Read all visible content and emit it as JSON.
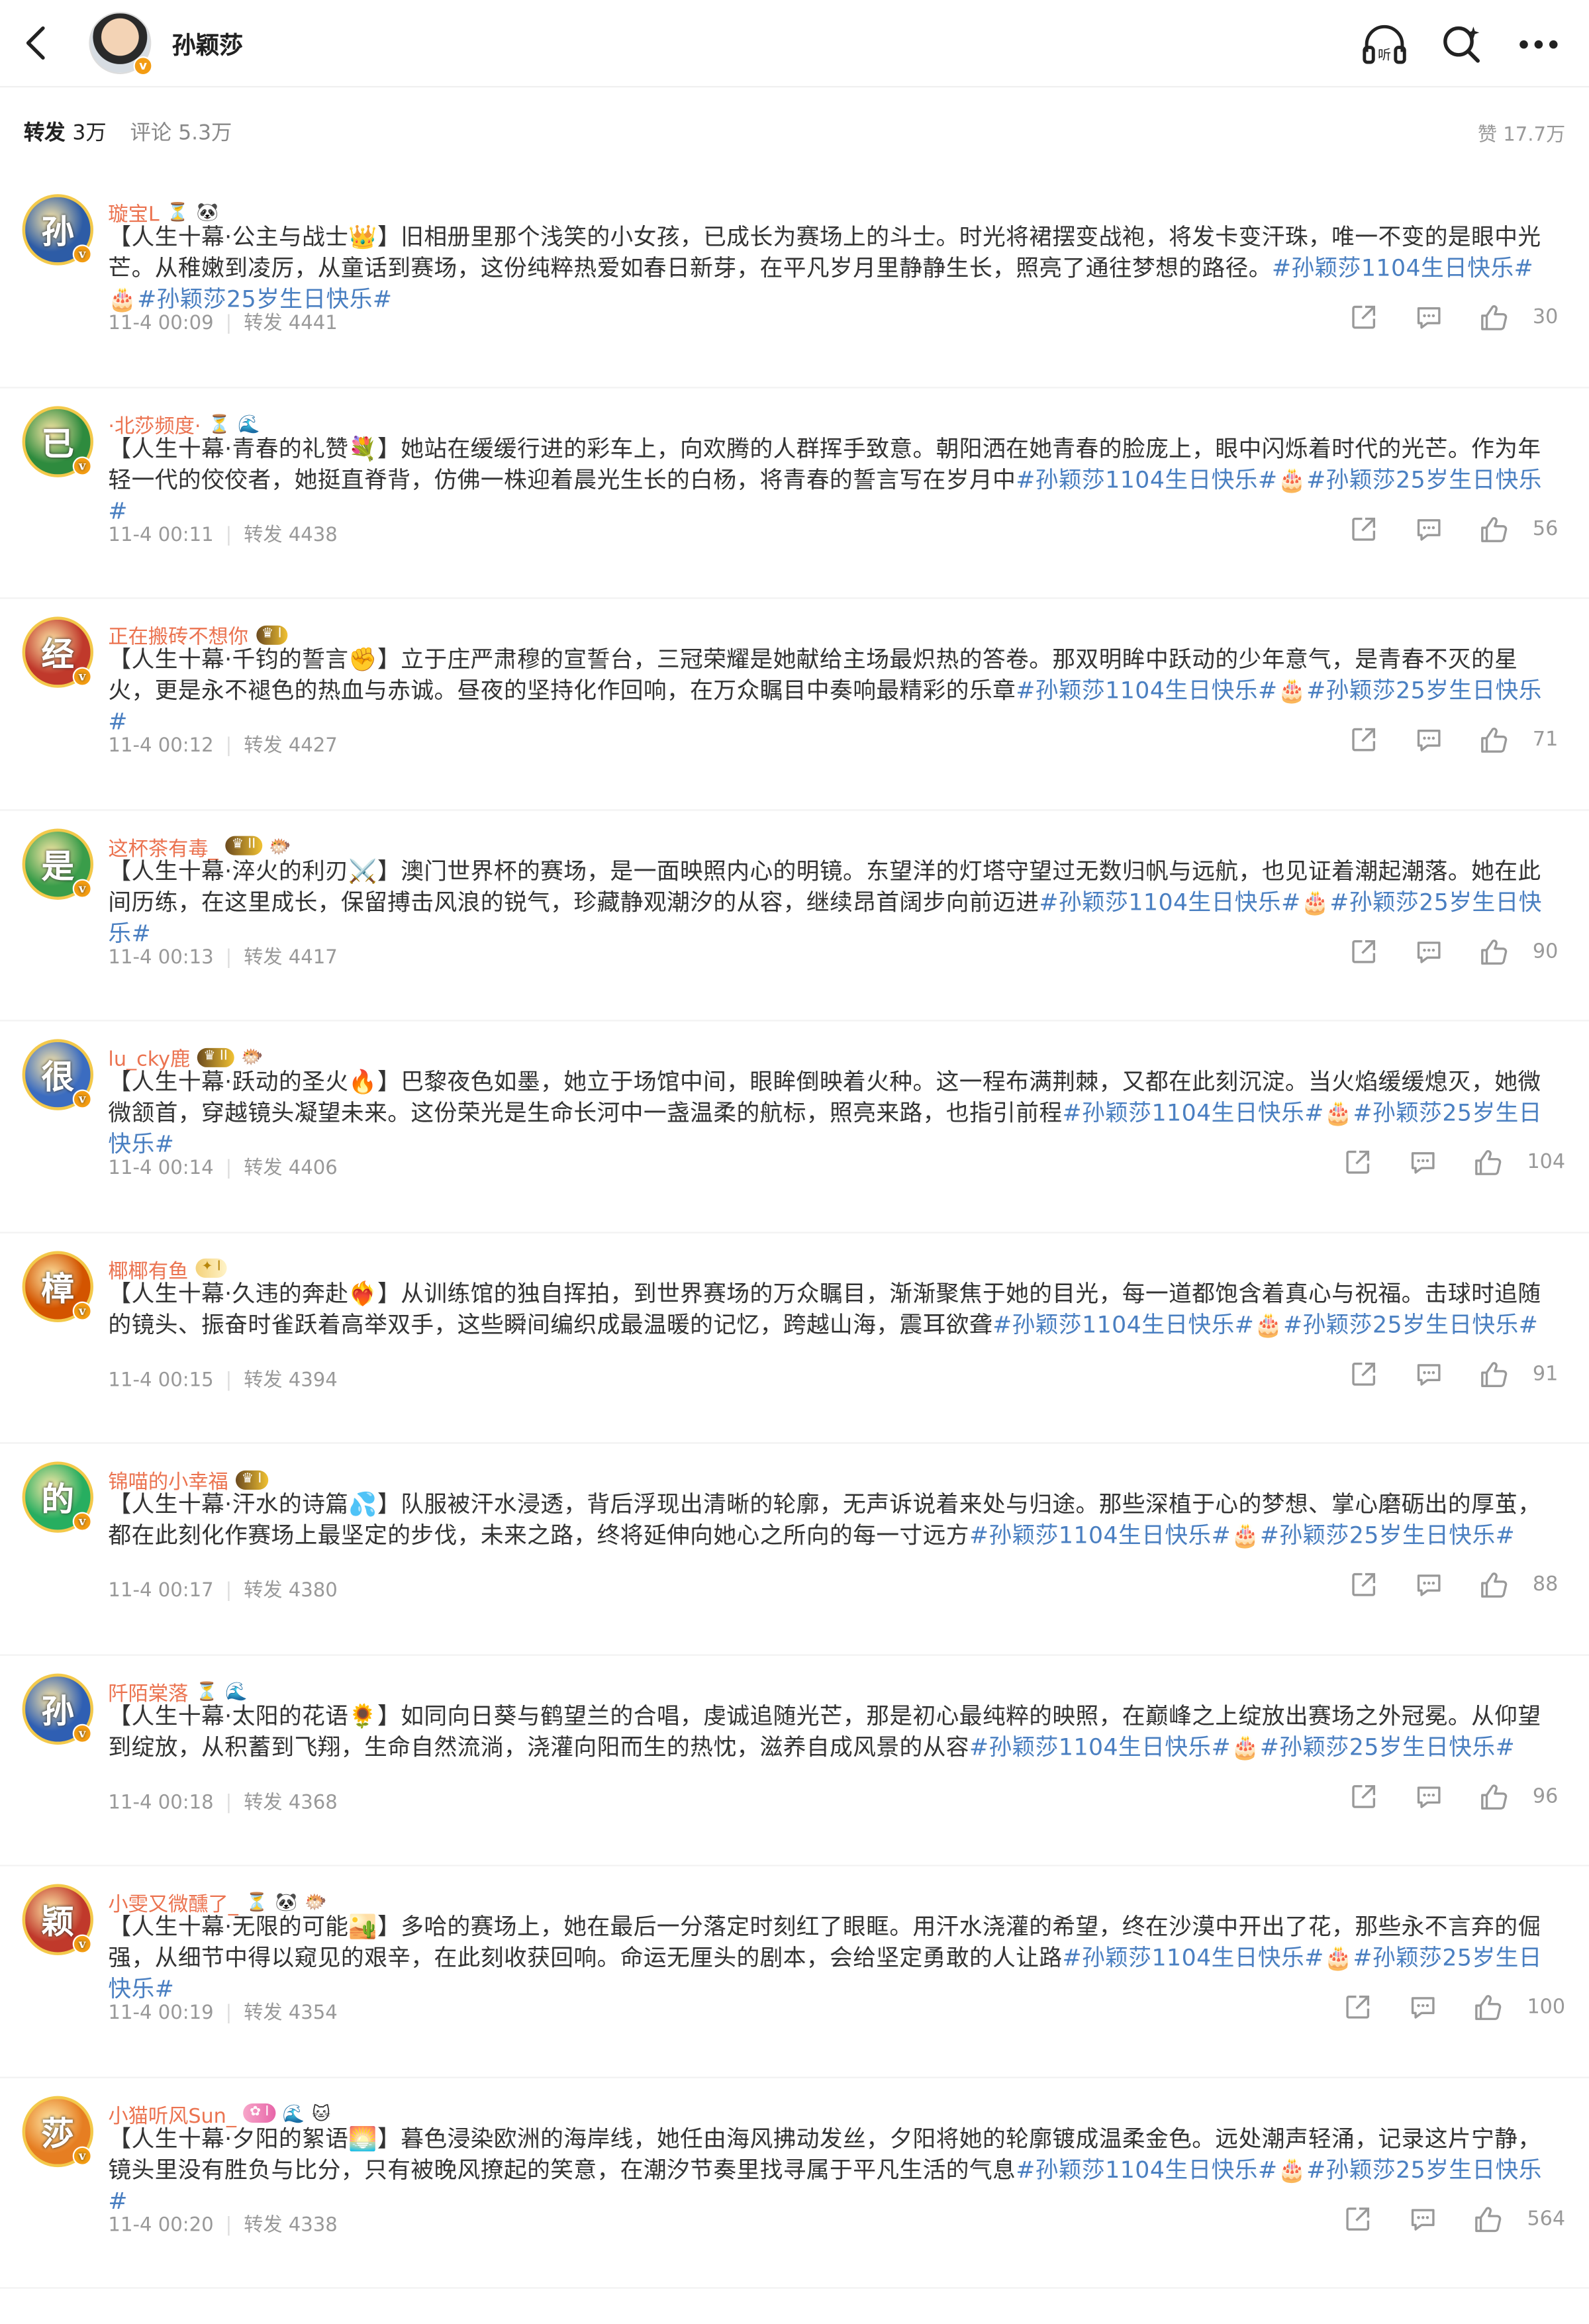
{
  "header": {
    "name": "孙颖莎",
    "listen_label": "听"
  },
  "tabs": {
    "repost": "转发",
    "repost_count": "3万",
    "comment": "评论",
    "comment_count": "5.3万",
    "likes": "赞 17.7万"
  },
  "colors": {
    "username": "#eb7350",
    "hashtag": "#4a7fc1",
    "meta": "#999999"
  },
  "comments": [
    {
      "avatar_char": "孙",
      "avatar_color": "#2d5ca6",
      "username": "璇宝L",
      "badges": [
        "hourglass-icon",
        "panda-icon"
      ],
      "text_main": "【人生十幕·公主与战士👑】旧相册里那个浅笑的小女孩，已成长为赛场上的斗士。时光将裙摆变战袍，将发卡变汗珠，唯一不变的是眼中光芒。从稚嫩到凌厉，从童话到赛场，这份纯粹热爱如春日新芽，在平凡岁月里静静生长，照亮了通往梦想的路径。",
      "tag1": "#孙颖莎1104生日快乐#",
      "tag_cake": "🎂",
      "tag2": "#孙颖莎25岁生日快乐#",
      "time": "11-4 00:09",
      "repost": "转发 4441",
      "likes": "30"
    },
    {
      "avatar_char": "已",
      "avatar_color": "#2e8b3e",
      "username": "·北莎频度·",
      "badges": [
        "hourglass-icon",
        "wave-icon"
      ],
      "text_main": "【人生十幕·青春的礼赞💐】她站在缓缓行进的彩车上，向欢腾的人群挥手致意。朝阳洒在她青春的脸庞上，眼中闪烁着时代的光芒。作为年轻一代的佼佼者，她挺直脊背，仿佛一株迎着晨光生长的白杨，将青春的誓言写在岁月中",
      "tag1": "#孙颖莎1104生日快乐#",
      "tag_cake": "🎂",
      "tag2": "#孙颖莎25岁生日快乐#",
      "time": "11-4 00:11",
      "repost": "转发 4438",
      "likes": "56"
    },
    {
      "avatar_char": "经",
      "avatar_color": "#c0392b",
      "username": "正在搬砖不想你",
      "badges": [
        "crown-medal-1"
      ],
      "text_main": "【人生十幕·千钧的誓言✊】立于庄严肃穆的宣誓台，三冠荣耀是她献给主场最炽热的答卷。那双明眸中跃动的少年意气，是青春不灭的星火，更是永不褪色的热血与赤诚。昼夜的坚持化作回响，在万众瞩目中奏响最精彩的乐章",
      "tag1": "#孙颖莎1104生日快乐#",
      "tag_cake": "🎂",
      "tag2": "#孙颖莎25岁生日快乐#",
      "time": "11-4 00:12",
      "repost": "转发 4427",
      "likes": "71"
    },
    {
      "avatar_char": "是",
      "avatar_color": "#3a9d4a",
      "username": "这杯茶有毒_",
      "badges": [
        "crown-medal-2",
        "fish-icon"
      ],
      "text_main": "【人生十幕·淬火的利刃⚔️】澳门世界杯的赛场，是一面映照内心的明镜。东望洋的灯塔守望过无数归帆与远航，也见证着潮起潮落。她在此间历练，在这里成长，保留搏击风浪的锐气，珍藏静观潮汐的从容，继续昂首阔步向前迈进",
      "tag1": "#孙颖莎1104生日快乐#",
      "tag_cake": "🎂",
      "tag2": "#孙颖莎25岁生日快乐#",
      "time": "11-4 00:13",
      "repost": "转发 4417",
      "likes": "90"
    },
    {
      "avatar_char": "很",
      "avatar_color": "#3b6cc0",
      "username": "lu_cky鹿",
      "badges": [
        "crown-medal-2",
        "fish-icon"
      ],
      "text_main": "【人生十幕·跃动的圣火🔥】巴黎夜色如墨，她立于场馆中间，眼眸倒映着火种。这一程布满荆棘，又都在此刻沉淀。当火焰缓缓熄灭，她微微颔首，穿越镜头凝望未来。这份荣光是生命长河中一盏温柔的航标，照亮来路，也指引前程",
      "tag1": "#孙颖莎1104生日快乐#",
      "tag_cake": "🎂",
      "tag2": "#孙颖莎25岁生日快乐#",
      "time": "11-4 00:14",
      "repost": "转发 4406",
      "likes": "104"
    },
    {
      "avatar_char": "樟",
      "avatar_color": "#d35400",
      "username": "椰椰有鱼",
      "badges": [
        "star-medal-1"
      ],
      "text_main": "【人生十幕·久违的奔赴❤️‍🔥】从训练馆的独自挥拍，到世界赛场的万众瞩目，渐渐聚焦于她的目光，每一道都饱含着真心与祝福。击球时追随的镜头、振奋时雀跃着高举双手，这些瞬间编织成最温暖的记忆，跨越山海，震耳欲聋",
      "tag1": "#孙颖莎1104生日快乐#",
      "tag_cake": "🎂",
      "tag2": "#孙颖莎25岁生日快乐#",
      "time": "11-4 00:15",
      "repost": "转发 4394",
      "likes": "91"
    },
    {
      "avatar_char": "的",
      "avatar_color": "#27ae60",
      "username": "锦喵的小幸福",
      "badges": [
        "crown-medal-1"
      ],
      "text_main": "【人生十幕·汗水的诗篇💦】队服被汗水浸透，背后浮现出清晰的轮廓，无声诉说着来处与归途。那些深植于心的梦想、掌心磨砺出的厚茧，都在此刻化作赛场上最坚定的步伐，未来之路，终将延伸向她心之所向的每一寸远方",
      "tag1": "#孙颖莎1104生日快乐#",
      "tag_cake": "🎂",
      "tag2": "#孙颖莎25岁生日快乐#",
      "time": "11-4 00:17",
      "repost": "转发 4380",
      "likes": "88"
    },
    {
      "avatar_char": "孙",
      "avatar_color": "#2f5fb3",
      "username": "阡陌棠落",
      "badges": [
        "hourglass-icon",
        "wave-icon"
      ],
      "text_main": "【人生十幕·太阳的花语🌻】如同向日葵与鹤望兰的合唱，虔诚追随光芒，那是初心最纯粹的映照，在巅峰之上绽放出赛场之外冠冕。从仰望到绽放，从积蓄到飞翔，生命自然流淌，浇灌向阳而生的热忱，滋养自成风景的从容",
      "tag1": "#孙颖莎1104生日快乐#",
      "tag_cake": "🎂",
      "tag2": "#孙颖莎25岁生日快乐#",
      "time": "11-4 00:18",
      "repost": "转发 4368",
      "likes": "96"
    },
    {
      "avatar_char": "颖",
      "avatar_color": "#c0392b",
      "username": "小雯又微醺了_",
      "badges": [
        "hourglass-icon",
        "panda-icon",
        "fish-icon"
      ],
      "text_main": "【人生十幕·无限的可能🏜️】多哈的赛场上，她在最后一分落定时刻红了眼眶。用汗水浇灌的希望，终在沙漠中开出了花，那些永不言弃的倔强，从细节中得以窥见的艰辛，在此刻收获回响。命运无厘头的剧本，会给坚定勇敢的人让路",
      "tag1": "#孙颖莎1104生日快乐#",
      "tag_cake": "🎂",
      "tag2": "#孙颖莎25岁生日快乐#",
      "time": "11-4 00:19",
      "repost": "转发 4354",
      "likes": "100"
    },
    {
      "avatar_char": "莎",
      "avatar_color": "#e67e22",
      "username": "小猫听风Sun_",
      "badges": [
        "pink-medal-1",
        "wave-icon",
        "cat-icon"
      ],
      "text_main": "【人生十幕·夕阳的絮语🌅】暮色浸染欧洲的海岸线，她任由海风拂动发丝，夕阳将她的轮廓镀成温柔金色。远处潮声轻涌，记录这片宁静，镜头里没有胜负与比分，只有被晚风撩起的笑意，在潮汐节奏里找寻属于平凡生活的气息",
      "tag1": "#孙颖莎1104生日快乐#",
      "tag_cake": "🎂",
      "tag2": "#孙颖莎25岁生日快乐#",
      "time": "11-4 00:20",
      "repost": "转发 4338",
      "likes": "564"
    }
  ]
}
